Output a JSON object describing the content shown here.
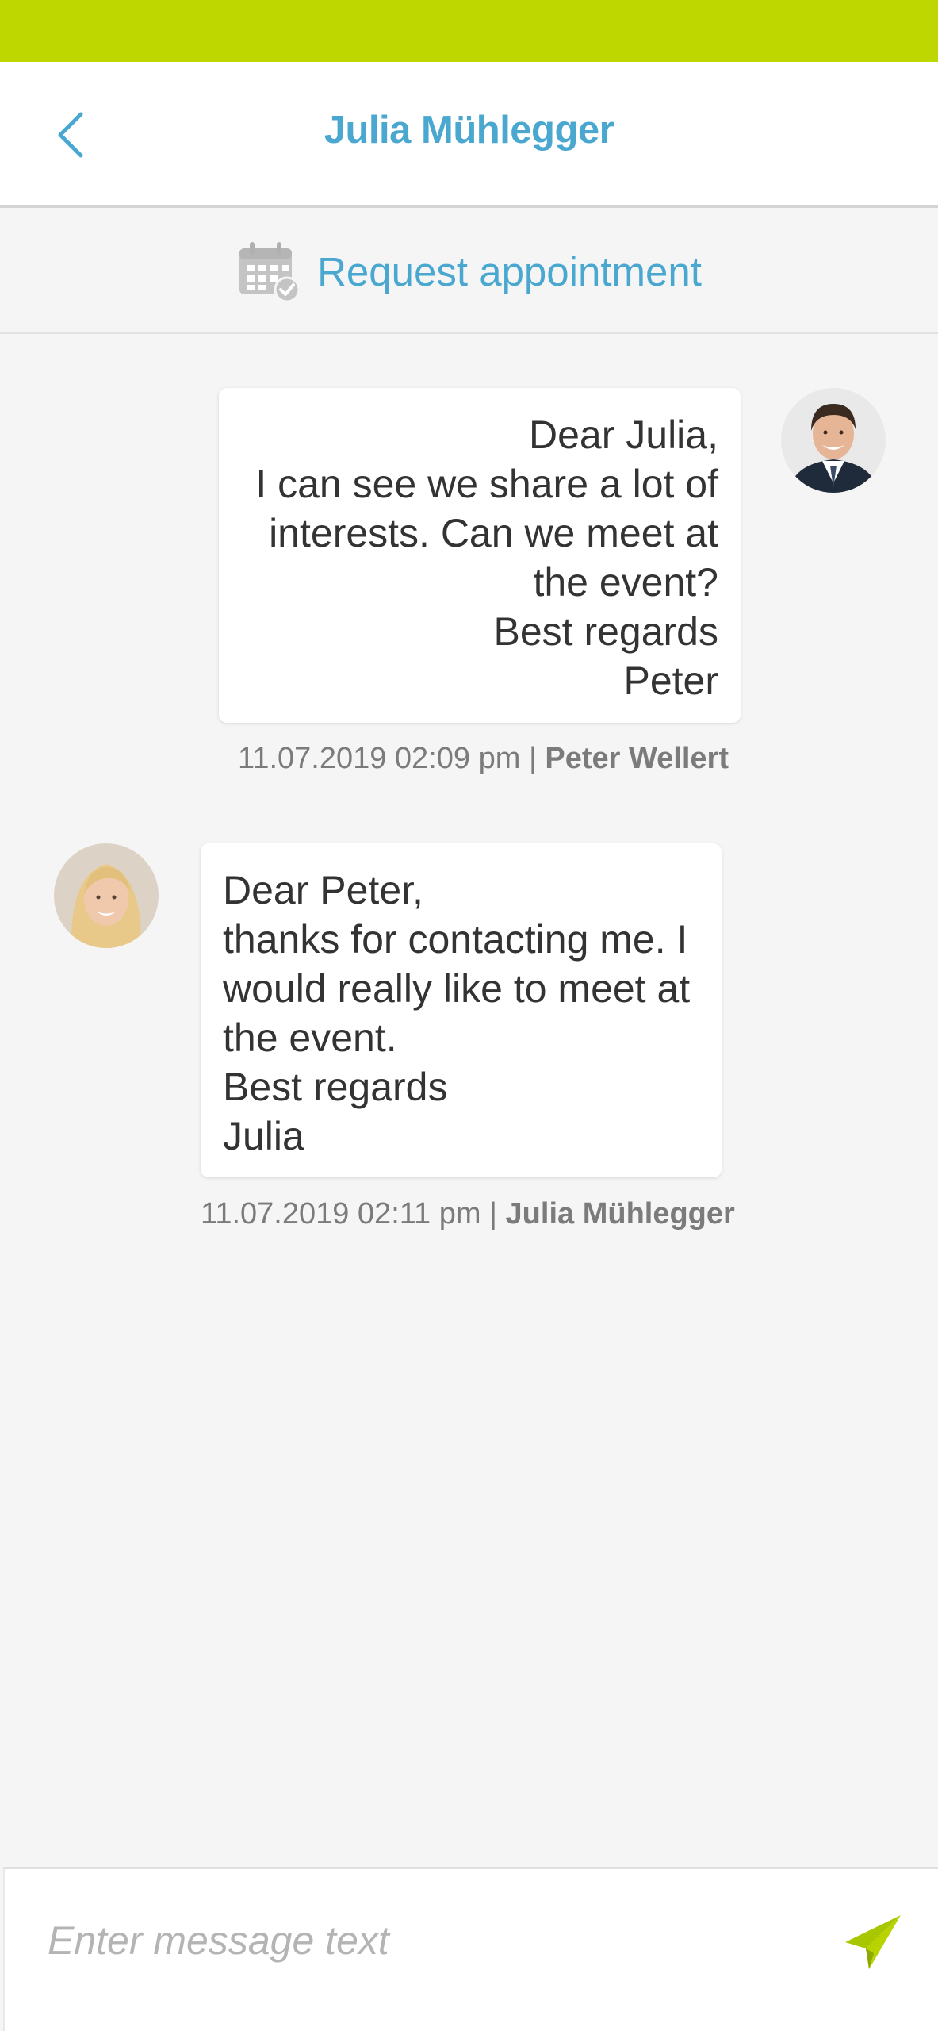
{
  "header": {
    "title": "Julia Mühlegger",
    "back_icon": "chevron-left-icon"
  },
  "appointment": {
    "label": "Request appointment",
    "icon": "calendar-check-icon"
  },
  "messages": [
    {
      "side": "right",
      "text": "Dear Julia,\nI can see we share a lot of interests. Can we meet at the event?\nBest regards\nPeter",
      "timestamp": "11.07.2019 02:09 pm",
      "separator": "|",
      "author": "Peter Wellert"
    },
    {
      "side": "left",
      "text": "Dear Peter,\nthanks for contacting me. I would really like to meet at the event.\nBest regards\nJulia",
      "timestamp": "11.07.2019 02:11 pm",
      "separator": "|",
      "author": "Julia Mühlegger"
    }
  ],
  "composer": {
    "placeholder": "Enter message text",
    "send_icon": "paper-plane-icon"
  },
  "colors": {
    "status_bar": "#bfd700",
    "accent": "#4aa8d0",
    "send": "#a9c700"
  }
}
